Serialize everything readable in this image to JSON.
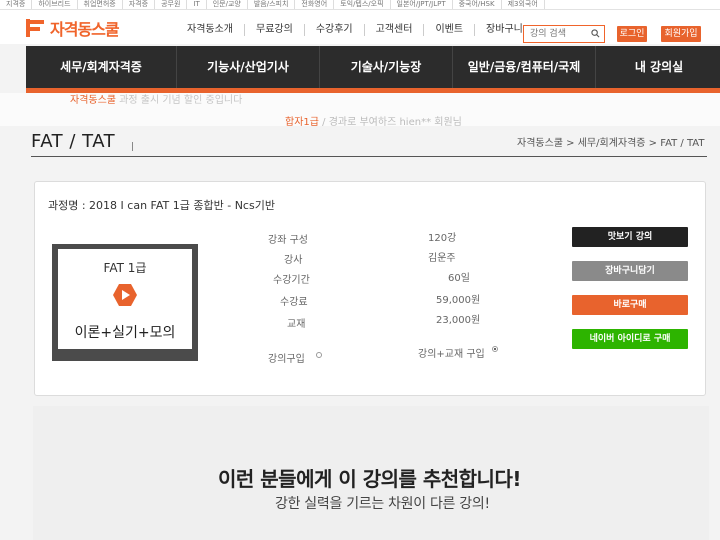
{
  "top_links": [
    "지격증",
    "하이브리드",
    "취업면허증",
    "자격증",
    "공무원",
    "IT",
    "인문/교양",
    "발음/스피치",
    "전화영어",
    "토익/텝스/오픽",
    "일본어/JPT/JLPT",
    "중국어/HSK",
    "제3외국어"
  ],
  "logo": {
    "text": "자격동스쿨"
  },
  "header": {
    "nav": [
      "자격동소개",
      "무료강의",
      "수강후기",
      "고객센터",
      "이벤트",
      "장바구니"
    ],
    "search_placeholder": "강의 검색",
    "login_label": "로그인",
    "signup_label": "회원가입"
  },
  "main_nav": [
    "세무/회계자격증",
    "기능사/산업기사",
    "기술사/기능장",
    "일반/금융/컴퓨터/국제",
    "내 강의실"
  ],
  "banner": {
    "line1_hl": "자격동스쿨",
    "line1": "과정 출시 기념 할인 중입니다",
    "line2_hl": "합자1급",
    "line2": "/ 경과로 부여하즈 hien** 회원님"
  },
  "page": {
    "title": "FAT / TAT",
    "breadcrumb": "자격동스쿨 > 세무/회계자격증 > FAT / TAT"
  },
  "course": {
    "name": "과정명 : 2018 I can FAT 1급 종합반 - Ncs기반",
    "thumb_title": "FAT 1급",
    "thumb_sub": "이론+실기+모의",
    "rows": [
      {
        "label": "강좌 구성",
        "value": "120강"
      },
      {
        "label": "강사",
        "value": "김운주"
      },
      {
        "label": "수강기간",
        "value": "60일"
      },
      {
        "label": "수강료",
        "value": "59,000원"
      },
      {
        "label": "교재",
        "value": "23,000원"
      }
    ],
    "option_lecture": "강의구입",
    "option_bundle": "강의+교재 구입"
  },
  "actions": {
    "preview": "맛보기 강의",
    "cart": "장바구니담기",
    "buy": "바로구매",
    "naver": "네이버 아이디로 구매"
  },
  "recommend": {
    "title": "이런 분들에게 이 강의를 추천합니다!",
    "subtitle": "강한 실력을 기르는 차원이 다른 강의!"
  },
  "colors": {
    "accent": "#e8632d",
    "nav_bg": "#2c2c2c",
    "cart_gray": "#8a8a8a",
    "naver_green": "#2db400"
  }
}
